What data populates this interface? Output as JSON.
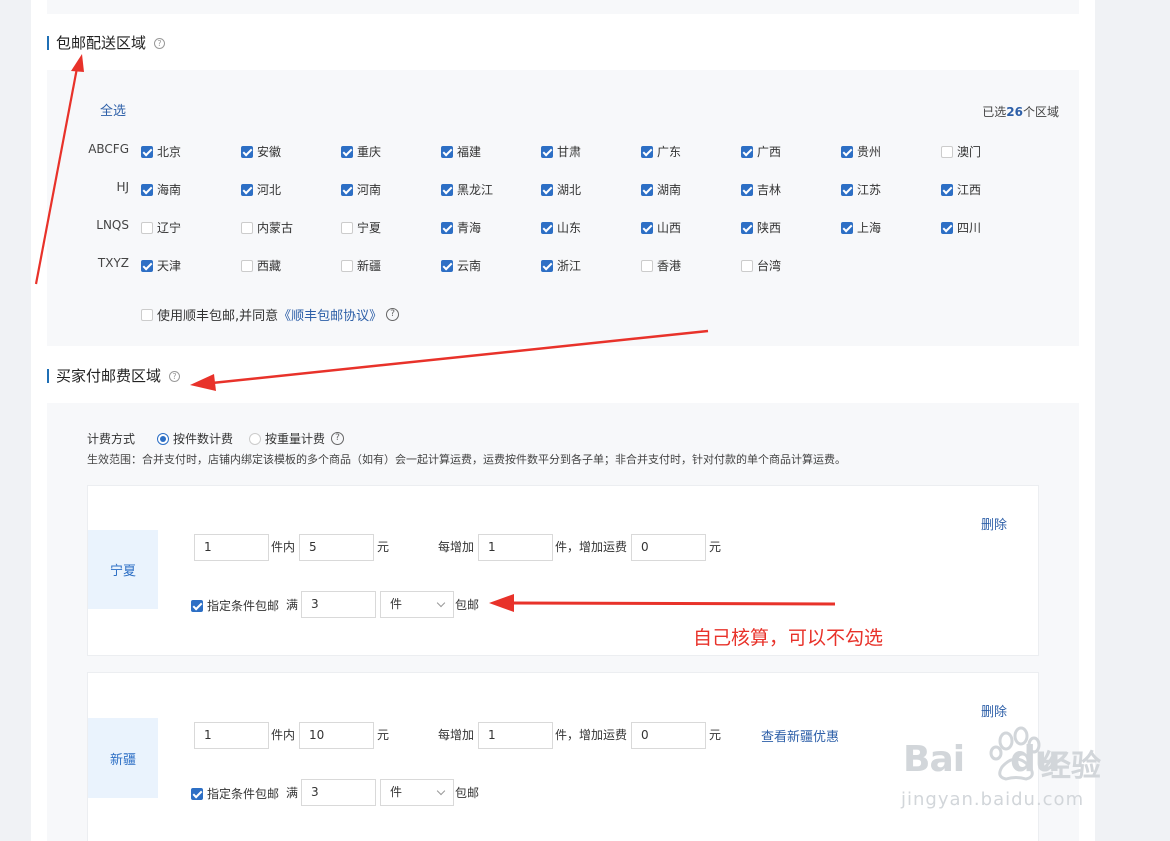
{
  "free_shipping_section": {
    "title": "包邮配送区域",
    "select_all": "全选",
    "selected_prefix": "已选",
    "selected_count": "26",
    "selected_suffix": "个区域",
    "rows": [
      {
        "label": "ABCFG",
        "items": [
          {
            "name": "北京",
            "checked": true
          },
          {
            "name": "安徽",
            "checked": true
          },
          {
            "name": "重庆",
            "checked": true
          },
          {
            "name": "福建",
            "checked": true
          },
          {
            "name": "甘肃",
            "checked": true
          },
          {
            "name": "广东",
            "checked": true
          },
          {
            "name": "广西",
            "checked": true
          },
          {
            "name": "贵州",
            "checked": true
          },
          {
            "name": "澳门",
            "checked": false
          }
        ]
      },
      {
        "label": "HJ",
        "items": [
          {
            "name": "海南",
            "checked": true
          },
          {
            "name": "河北",
            "checked": true
          },
          {
            "name": "河南",
            "checked": true
          },
          {
            "name": "黑龙江",
            "checked": true
          },
          {
            "name": "湖北",
            "checked": true
          },
          {
            "name": "湖南",
            "checked": true
          },
          {
            "name": "吉林",
            "checked": true
          },
          {
            "name": "江苏",
            "checked": true
          },
          {
            "name": "江西",
            "checked": true
          }
        ]
      },
      {
        "label": "LNQS",
        "items": [
          {
            "name": "辽宁",
            "checked": false
          },
          {
            "name": "内蒙古",
            "checked": false
          },
          {
            "name": "宁夏",
            "checked": false
          },
          {
            "name": "青海",
            "checked": true
          },
          {
            "name": "山东",
            "checked": true
          },
          {
            "name": "山西",
            "checked": true
          },
          {
            "name": "陕西",
            "checked": true
          },
          {
            "name": "上海",
            "checked": true
          },
          {
            "name": "四川",
            "checked": true
          }
        ]
      },
      {
        "label": "TXYZ",
        "items": [
          {
            "name": "天津",
            "checked": true
          },
          {
            "name": "西藏",
            "checked": false
          },
          {
            "name": "新疆",
            "checked": false
          },
          {
            "name": "云南",
            "checked": true
          },
          {
            "name": "浙江",
            "checked": true
          },
          {
            "name": "香港",
            "checked": false
          },
          {
            "name": "台湾",
            "checked": false
          }
        ]
      }
    ],
    "sf_agree_text": "使用顺丰包邮,并同意",
    "sf_agree_link": "《顺丰包邮协议》"
  },
  "buyer_pay_section": {
    "title": "买家付邮费区域",
    "billing_label": "计费方式",
    "billing_options": [
      {
        "label": "按件数计费",
        "selected": true
      },
      {
        "label": "按重量计费",
        "selected": false
      }
    ],
    "scope_note": "生效范围：合并支付时，店铺内绑定该模板的多个商品（如有）会一起计算运费，运费按件数平分到各子单；非合并支付时，针对付款的单个商品计算运费。",
    "cards": [
      {
        "region": "宁夏",
        "delete": "删除",
        "first_count": "1",
        "within_label": "件内",
        "first_fee": "5",
        "yuan": "元",
        "each_add_label": "每增加",
        "add_count": "1",
        "add_fee_label": "件，增加运费",
        "add_fee": "0",
        "yuan2": "元",
        "extra_link": "",
        "cond_checked": true,
        "cond_label": "指定条件包邮",
        "full_label": "满",
        "cond_value": "3",
        "cond_unit": "件",
        "free_label": "包邮"
      },
      {
        "region": "新疆",
        "delete": "删除",
        "first_count": "1",
        "within_label": "件内",
        "first_fee": "10",
        "yuan": "元",
        "each_add_label": "每增加",
        "add_count": "1",
        "add_fee_label": "件，增加运费",
        "add_fee": "0",
        "yuan2": "元",
        "extra_link": "查看新疆优惠",
        "cond_checked": true,
        "cond_label": "指定条件包邮",
        "full_label": "满",
        "cond_value": "3",
        "cond_unit": "件",
        "free_label": "包邮"
      }
    ]
  },
  "annotation": {
    "text": "自己核算，可以不勾选",
    "color": "#e8322a"
  },
  "watermark": {
    "brand": "Bai",
    "brand2": "du",
    "cn": "经验",
    "url": "jingyan.baidu.com"
  },
  "colors": {
    "accent": "#2d6fc5",
    "link": "#2d5fa8",
    "panel": "#f7f8fa",
    "annotation": "#e8322a"
  }
}
